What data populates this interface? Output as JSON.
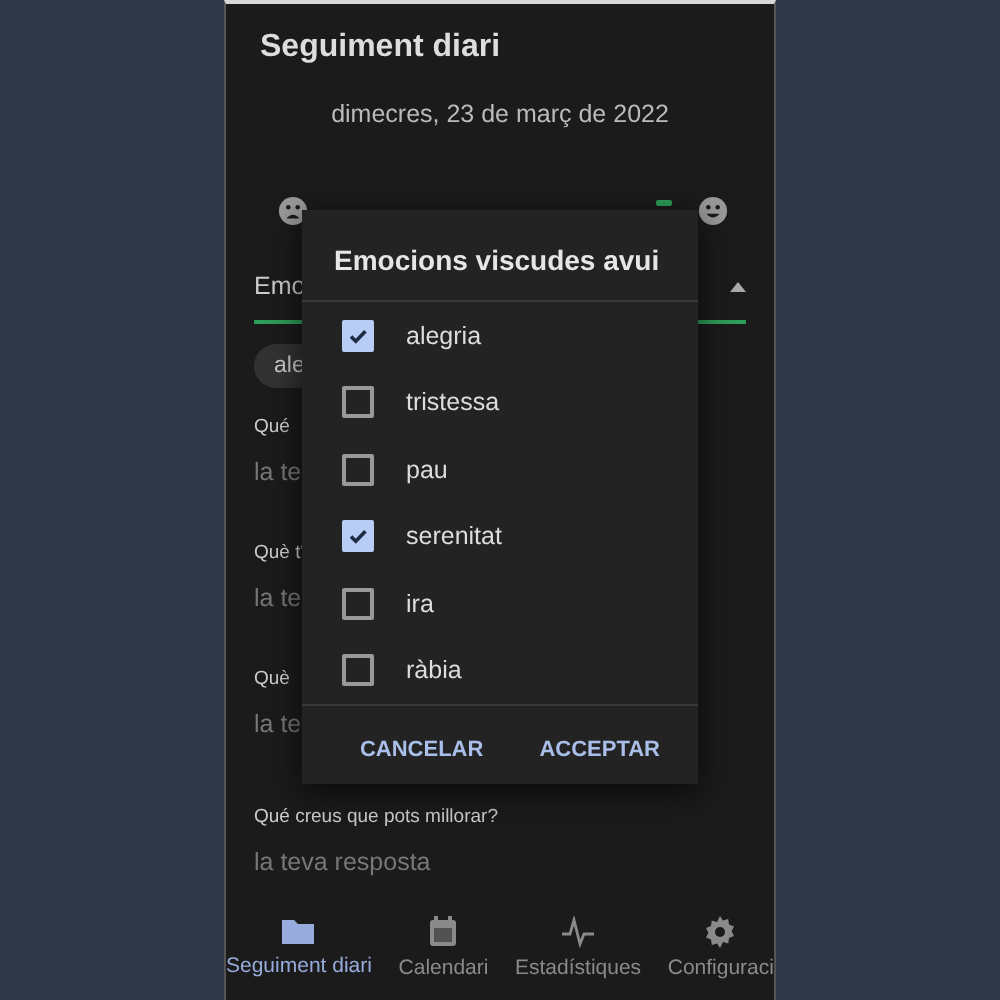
{
  "header": {
    "title": "Seguiment diari"
  },
  "date": "dimecres, 23 de març de 2022",
  "emotions_field": {
    "label": "Emo",
    "chip": "ale"
  },
  "questions": [
    {
      "label": "Qué",
      "placeholder": "la te"
    },
    {
      "label": "Què t'",
      "placeholder": "la te"
    },
    {
      "label": "Què",
      "placeholder": "la te"
    },
    {
      "label": "Qué creus que pots millorar?",
      "placeholder": "la teva resposta"
    }
  ],
  "dialog": {
    "title": "Emocions viscudes avui",
    "options": [
      {
        "label": "alegria",
        "checked": true
      },
      {
        "label": "tristessa",
        "checked": false
      },
      {
        "label": "pau",
        "checked": false
      },
      {
        "label": "serenitat",
        "checked": true
      },
      {
        "label": "ira",
        "checked": false
      },
      {
        "label": "ràbia",
        "checked": false
      }
    ],
    "buttons": [
      "CANCELAR",
      "ACCEPTAR"
    ]
  },
  "nav": [
    {
      "label": "Seguiment diari",
      "kind": "folder",
      "selected": true
    },
    {
      "label": "Calendari",
      "kind": "calendar",
      "selected": false
    },
    {
      "label": "Estadístiques",
      "kind": "pulse",
      "selected": false
    },
    {
      "label": "Configuraci",
      "kind": "gear",
      "selected": false
    }
  ]
}
